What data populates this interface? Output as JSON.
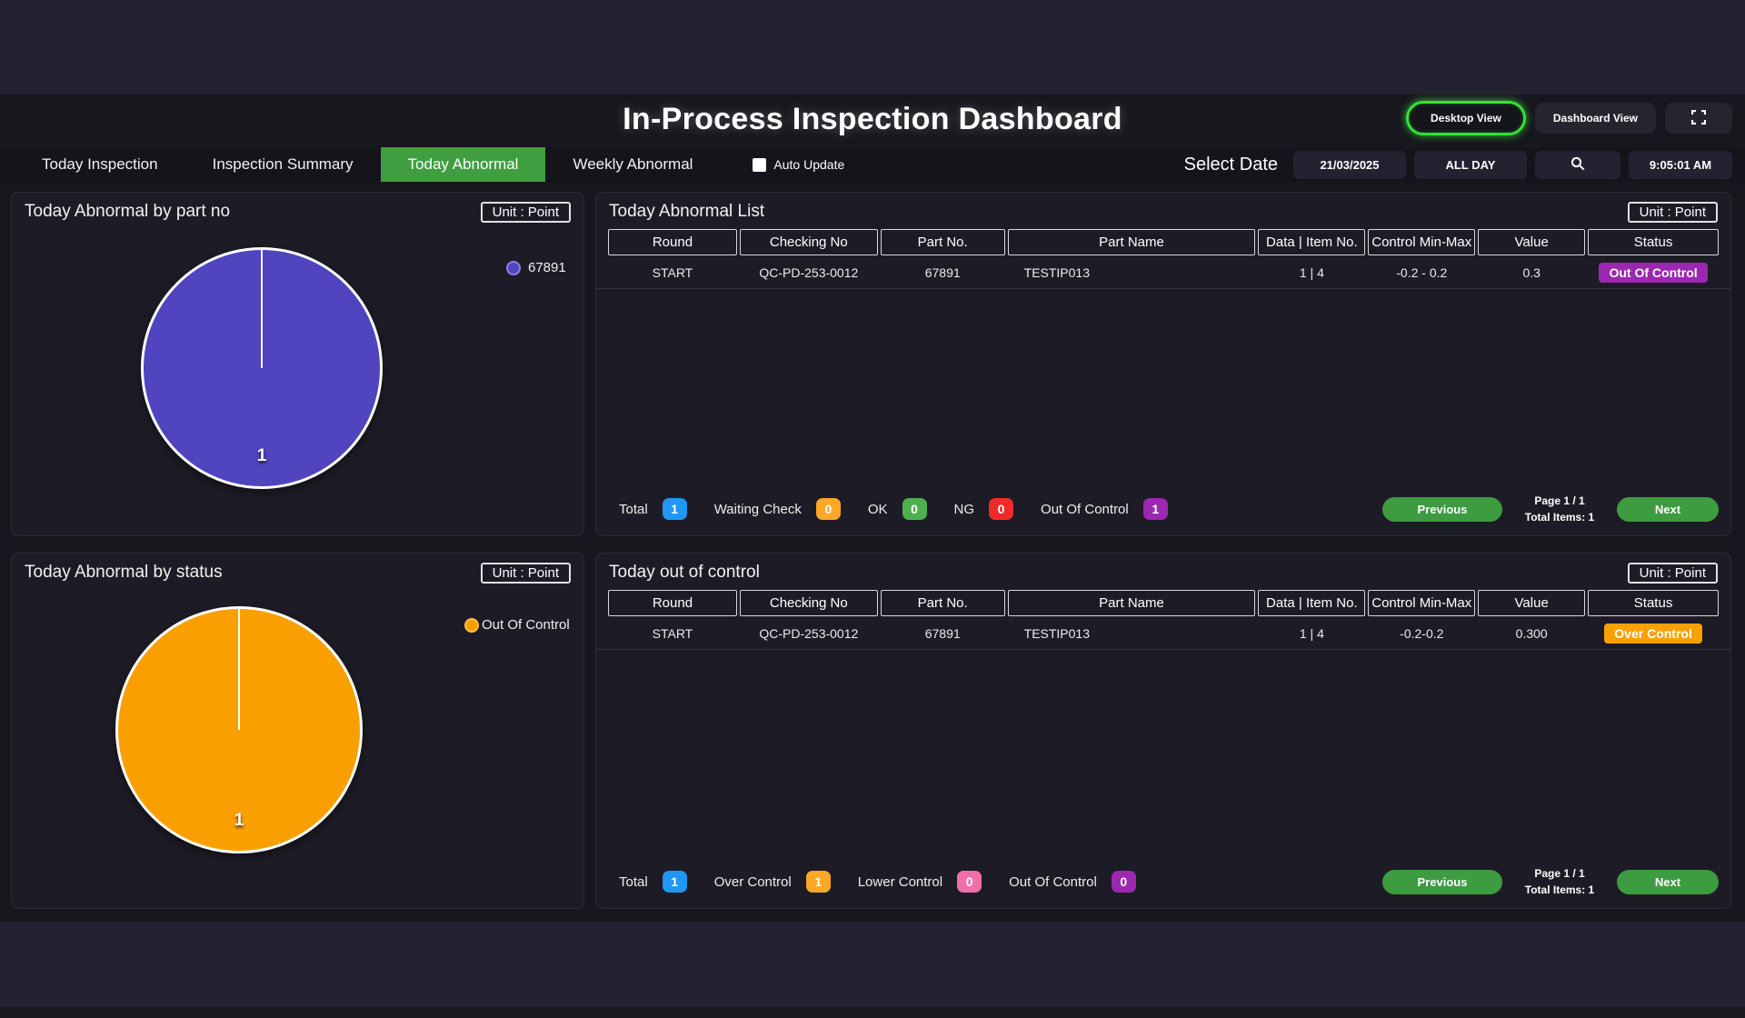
{
  "colors": {
    "accent_green": "#3f9e3f",
    "button_glow_green": "#35e135",
    "count_blue": "#2196f3",
    "count_orange": "#ffa726",
    "count_green": "#4caf50",
    "count_red": "#f32a2a",
    "count_purple": "#9c27b0",
    "count_pink": "#f06fa8",
    "pie_purple": "#5045be",
    "pie_orange": "#f9a000",
    "status_out_of_control_badge": "#9c27b0",
    "status_over_control_badge": "#f9a100"
  },
  "icons": {
    "search": "search-icon",
    "fullscreen": "fullscreen-icon",
    "auto_update_checkbox": "checkbox-unchecked"
  },
  "header": {
    "title": "In-Process Inspection Dashboard",
    "desktop_view_label": "Desktop View",
    "dashboard_view_label": "Dashboard View"
  },
  "nav": {
    "tabs": [
      {
        "label": "Today Inspection",
        "active": false
      },
      {
        "label": "Inspection Summary",
        "active": false
      },
      {
        "label": "Today Abnormal",
        "active": true
      },
      {
        "label": "Weekly Abnormal",
        "active": false
      }
    ],
    "auto_update_label": "Auto Update",
    "auto_update_checked": false,
    "select_date_label": "Select Date",
    "date_value": "21/03/2025",
    "day_range_value": "ALL DAY",
    "time_value": "9:05:01 AM"
  },
  "panel_by_part_no": {
    "title": "Today Abnormal by part no",
    "unit_badge": "Unit : Point",
    "slice_value": "1",
    "legend_label": "67891"
  },
  "panel_abnormal_list": {
    "title": "Today Abnormal List",
    "unit_badge": "Unit : Point",
    "columns": [
      "Round",
      "Checking No",
      "Part No.",
      "Part Name",
      "Data | Item No.",
      "Control Min-Max",
      "Value",
      "Status"
    ],
    "row": {
      "round": "START",
      "checking_no": "QC-PD-253-0012",
      "part_no": "67891",
      "part_name": "TESTIP013",
      "data_item_no": "1 | 4",
      "control_min_max": "-0.2 - 0.2",
      "value": "0.3",
      "status": "Out Of Control"
    },
    "summary": [
      {
        "label": "Total",
        "count": "1",
        "color": "#2196f3"
      },
      {
        "label": "Waiting Check",
        "count": "0",
        "color": "#ffa726"
      },
      {
        "label": "OK",
        "count": "0",
        "color": "#4caf50"
      },
      {
        "label": "NG",
        "count": "0",
        "color": "#f32a2a"
      },
      {
        "label": "Out Of Control",
        "count": "1",
        "color": "#9c27b0"
      }
    ],
    "pagination": {
      "previous_label": "Previous",
      "next_label": "Next",
      "page_text": "Page 1 / 1",
      "total_items_text": "Total Items: 1"
    }
  },
  "panel_by_status": {
    "title": "Today Abnormal by status",
    "unit_badge": "Unit : Point",
    "slice_value": "1",
    "legend_label": "Out Of Control"
  },
  "panel_out_of_control": {
    "title": "Today out of control",
    "unit_badge": "Unit : Point",
    "columns": [
      "Round",
      "Checking No",
      "Part No.",
      "Part Name",
      "Data | Item No.",
      "Control Min-Max",
      "Value",
      "Status"
    ],
    "row": {
      "round": "START",
      "checking_no": "QC-PD-253-0012",
      "part_no": "67891",
      "part_name": "TESTIP013",
      "data_item_no": "1 | 4",
      "control_min_max": "-0.2-0.2",
      "value": "0.300",
      "status": "Over Control"
    },
    "summary": [
      {
        "label": "Total",
        "count": "1",
        "color": "#2196f3"
      },
      {
        "label": "Over Control",
        "count": "1",
        "color": "#ffa726"
      },
      {
        "label": "Lower Control",
        "count": "0",
        "color": "#f06fa8"
      },
      {
        "label": "Out Of Control",
        "count": "0",
        "color": "#9c27b0"
      }
    ],
    "pagination": {
      "previous_label": "Previous",
      "next_label": "Next",
      "page_text": "Page 1 / 1",
      "total_items_text": "Total Items: 1"
    }
  },
  "chart_data": [
    {
      "type": "pie",
      "title": "Today Abnormal by part no",
      "unit": "Point",
      "slices": [
        {
          "label": "67891",
          "value": 1,
          "color": "#5045be"
        }
      ],
      "data_label": "1",
      "legend_position": "right"
    },
    {
      "type": "pie",
      "title": "Today Abnormal by status",
      "unit": "Point",
      "slices": [
        {
          "label": "Out Of Control",
          "value": 1,
          "color": "#f9a000"
        }
      ],
      "data_label": "1",
      "legend_position": "right"
    }
  ]
}
